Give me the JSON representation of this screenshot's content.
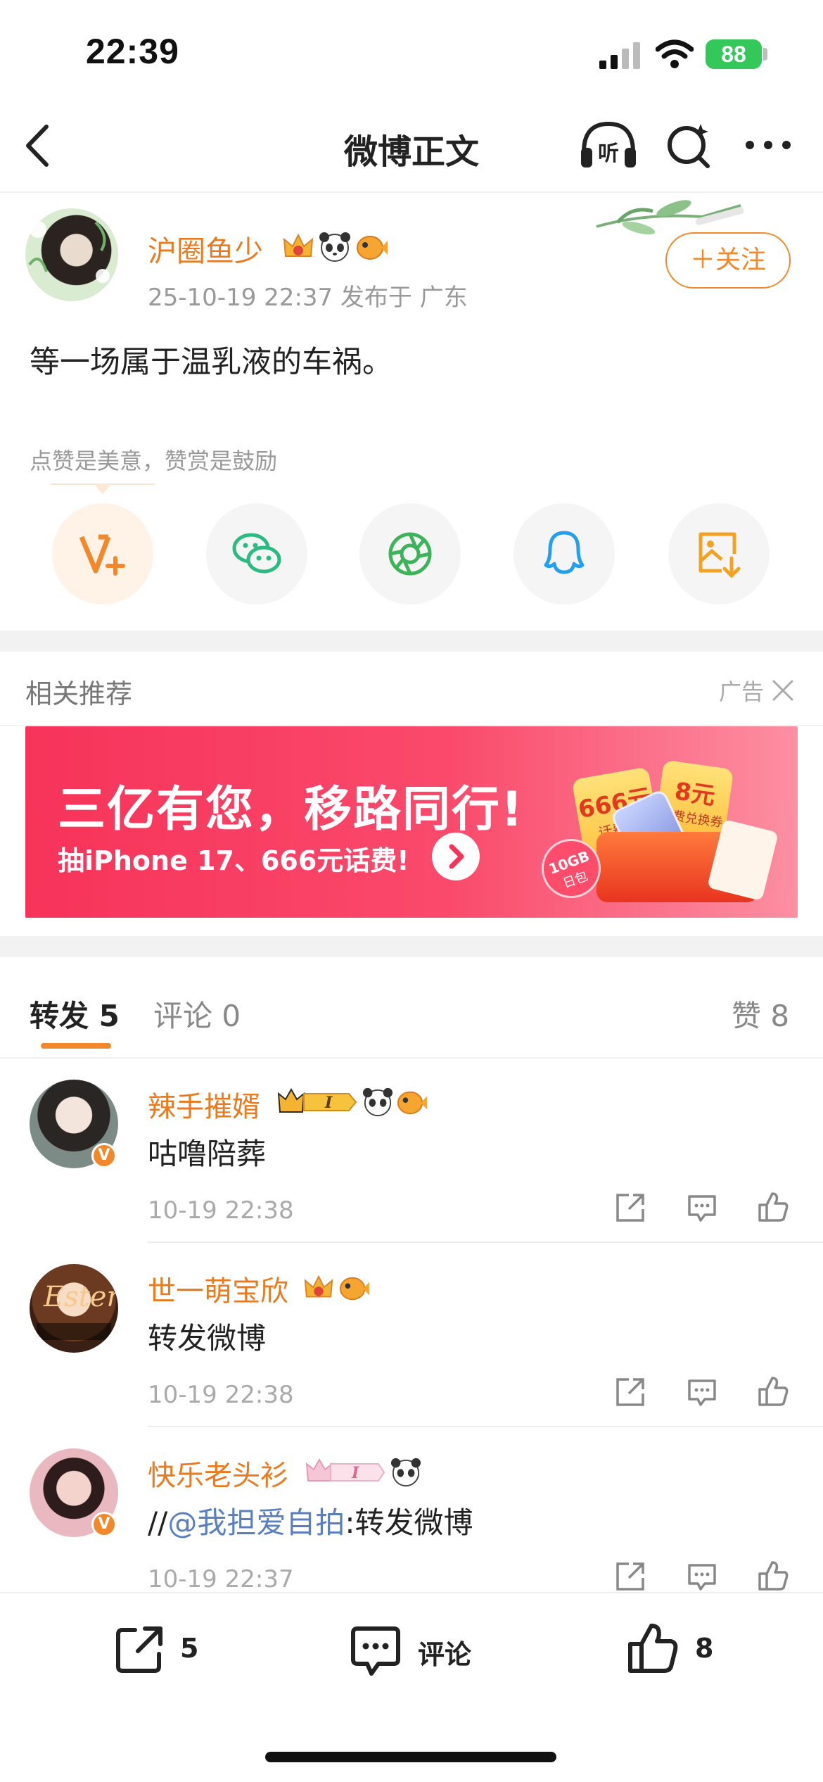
{
  "status_bar": {
    "time": "22:39",
    "battery": "88"
  },
  "nav": {
    "title": "微博正文"
  },
  "post": {
    "author": "沪圈鱼少",
    "meta": "25-10-19 22:37  发布于 广东",
    "follow_label": "＋关注",
    "text": "等一场属于温乳液的车祸。",
    "reward_hint": "点赞是美意，赞赏是鼓励"
  },
  "recommend": {
    "title": "相关推荐",
    "ad_label": "广告",
    "banner_title": "三亿有您，移路同行!",
    "banner_sub": "抽iPhone 17、666元话费!",
    "banner_tag_1": "666元",
    "banner_tag_1_sub": "话费券",
    "banner_tag_2": "8元",
    "banner_tag_2_sub": "话费兑换券",
    "banner_tag_3": "10GB",
    "banner_tag_3_sub": "日包"
  },
  "tabs": {
    "repost": "转发 5",
    "comment": "评论 0",
    "like": "赞 8"
  },
  "comments": [
    {
      "name": "辣手摧婿",
      "text": "咕噜陪葬",
      "time": "10-19 22:38"
    },
    {
      "name": "世一萌宝欣",
      "text": "转发微博",
      "time": "10-19 22:38"
    },
    {
      "name": "快乐老头衫",
      "text_prefix": "//",
      "mention": "@我担爱自拍",
      "text_suffix": ":转发微博",
      "time": "10-19 22:37"
    }
  ],
  "bottom_bar": {
    "repost_count": "5",
    "comment_label": "评论",
    "like_count": "8"
  },
  "colors": {
    "accent": "#f2882c",
    "name": "#ea7a1e",
    "banner": "#f7335a"
  }
}
